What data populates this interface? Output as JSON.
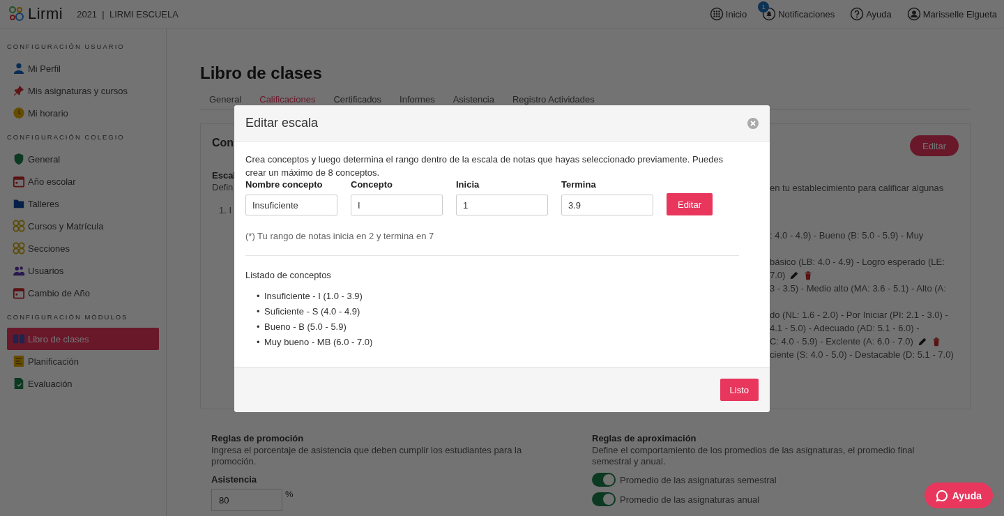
{
  "header": {
    "logo": "Lirmi",
    "year": "2021",
    "separator": "|",
    "school": "LIRMI ESCUELA",
    "nav": [
      {
        "kind": "home",
        "label": "Inicio"
      },
      {
        "kind": "bell",
        "label": "Notificaciones",
        "badge": "1"
      },
      {
        "kind": "help",
        "label": "Ayuda"
      },
      {
        "kind": "user",
        "label": "Marisselle Elgueta"
      }
    ]
  },
  "sidebar": {
    "sections": [
      {
        "title": "CONFIGURACIÓN USUARIO",
        "items": [
          {
            "label": "Mi Perfil",
            "selected": false
          },
          {
            "label": "Mis asignaturas y cursos",
            "selected": false
          },
          {
            "label": "Mi horario",
            "selected": false
          }
        ]
      },
      {
        "title": "CONFIGURACIÓN COLEGIO",
        "items": [
          {
            "label": "General",
            "selected": false
          },
          {
            "label": "Año escolar",
            "selected": false
          },
          {
            "label": "Talleres",
            "selected": false
          },
          {
            "label": "Cursos y Matrícula",
            "selected": false
          },
          {
            "label": "Secciones",
            "selected": false
          },
          {
            "label": "Usuarios",
            "selected": false
          },
          {
            "label": "Cambio de Año",
            "selected": false
          }
        ]
      },
      {
        "title": "CONFIGURACIÓN MÓDULOS",
        "items": [
          {
            "label": "Libro de clases",
            "selected": true
          },
          {
            "label": "Planificación",
            "selected": false
          },
          {
            "label": "Evaluación",
            "selected": false
          }
        ]
      }
    ]
  },
  "page": {
    "title": "Libro de clases",
    "tabs": [
      {
        "label": "General",
        "selected": false
      },
      {
        "label": "Calificaciones",
        "selected": true
      },
      {
        "label": "Certificados",
        "selected": false
      },
      {
        "label": "Informes",
        "selected": false
      },
      {
        "label": "Asistencia",
        "selected": false
      },
      {
        "label": "Registro Actividades",
        "selected": false
      }
    ],
    "card": {
      "heading": "Con",
      "edit_button": "Editar",
      "scale_title": "Escal",
      "scale_desc": "Defin",
      "list_start": "1. I",
      "desc_right": "en tu establecimiento para calificar algunas",
      "scale_items": [
        {
          "lines": [
            {
              "text": ": 4.0 - 4.9) - Bueno (B: 5.0 - 5.9) - Muy",
              "actions": false
            }
          ]
        },
        {
          "lines": [
            {
              "text": "básico (LB: 4.0 - 4.9) - Logro esperado (LE:",
              "actions": false
            },
            {
              "text": "7.0)",
              "actions": true
            }
          ]
        },
        {
          "lines": [
            {
              "text": "3 - 3.5) - Medio alto (MA: 3.6 - 5.1) - Alto (A:",
              "actions": false
            }
          ]
        },
        {
          "lines": [
            {
              "text": "do (NL: 1.6 - 2.0) - Por Iniciar (PI: 2.1 - 3.0) -",
              "actions": false
            },
            {
              "text": "4.1 - 5.0) - Adecuado (AD: 5.1 - 6.0) -",
              "actions": false
            }
          ]
        },
        {
          "lines": [
            {
              "text": "C: 4.0 - 5.9) - Exclente (A: 6.0 - 7.0)",
              "actions": true
            },
            {
              "text": "ciente (S: 4.0 - 5.0) - Destacable (D: 5.1 - 7.0)",
              "actions": false
            }
          ]
        }
      ]
    },
    "promotion": {
      "title": "Reglas de promoción",
      "desc": "Ingresa el porcentaje de asistencia que deben cumplir los estudiantes para la promoción.",
      "field_label": "Asistencia",
      "value": "80",
      "unit": "%"
    },
    "approximation": {
      "title": "Reglas de aproximación",
      "desc": "Define el comportamiento de los promedios de las asignaturas, el promedio final semestral y anual.",
      "toggles": [
        {
          "label": "Promedio de las asignaturas semestral",
          "on": true
        },
        {
          "label": "Promedio de las asignaturas anual",
          "on": true
        }
      ]
    }
  },
  "modal": {
    "title": "Editar escala",
    "intro": "Crea conceptos y luego determina el rango dentro de la escala de notas que hayas seleccionado previamente. Puedes crear un máximo de 8 conceptos.",
    "fields": [
      {
        "label": "Nombre concepto",
        "value": "Insuficiente"
      },
      {
        "label": "Concepto",
        "value": "I"
      },
      {
        "label": "Inicia",
        "value": "1"
      },
      {
        "label": "Termina",
        "value": "3.9"
      }
    ],
    "edit_button": "Editar",
    "note": "(*) Tu rango de notas inicia en 2 y termina en 7",
    "list_title": "Listado de conceptos",
    "concepts": [
      {
        "marker": "•",
        "text": "Insuficiente - I (1.0 - 3.9)"
      },
      {
        "marker": "•",
        "text": "Suficiente - S (4.0 - 4.9)"
      },
      {
        "marker": "•",
        "text": "Bueno - B (5.0 - 5.9)"
      },
      {
        "marker": "•",
        "text": "Muy bueno - MB (6.0 - 7.0)"
      }
    ],
    "done_button": "Listo"
  },
  "help_button": "Ayuda"
}
